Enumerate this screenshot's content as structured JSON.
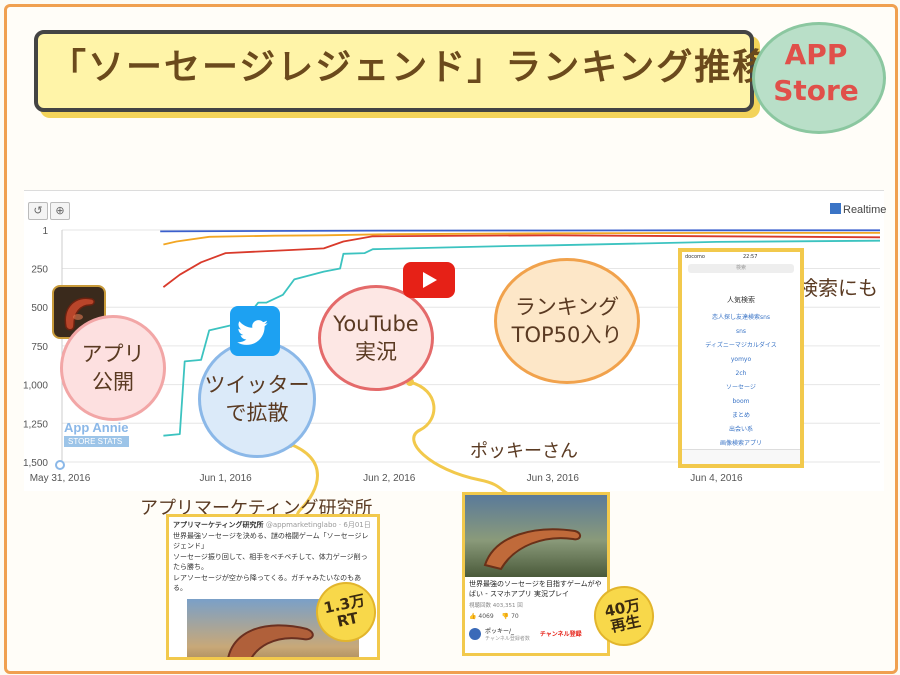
{
  "header": {
    "title": "「ソーセージレジェンド」ランキング推移",
    "badge_line1": "APP",
    "badge_line2": "Store"
  },
  "toolbar": {
    "realtime_label": "Realtime"
  },
  "chart_data": {
    "type": "line",
    "title": "",
    "xlabel": "",
    "ylabel": "",
    "y_inverted": true,
    "ylim": [
      1,
      1500
    ],
    "y_ticks": [
      "1",
      "250",
      "500",
      "750",
      "1,000",
      "1,250",
      "1,500"
    ],
    "y_tick_values": [
      1,
      250,
      500,
      750,
      1000,
      1250,
      1500
    ],
    "x_ticks": [
      "May 31, 2016",
      "Jun 1, 2016",
      "Jun 2, 2016",
      "Jun 3, 2016",
      "Jun 4, 2016"
    ],
    "x_tick_values": [
      0,
      1,
      2,
      3,
      4
    ],
    "xlim": [
      0,
      5
    ],
    "grid": "horizontal",
    "series": [
      {
        "color": "#3a5fcd",
        "points": [
          [
            0.6,
            10
          ],
          [
            1.0,
            8
          ],
          [
            2.0,
            5
          ],
          [
            3.0,
            4
          ],
          [
            4.0,
            3
          ],
          [
            5.0,
            3
          ]
        ]
      },
      {
        "color": "#f2a623",
        "points": [
          [
            0.62,
            95
          ],
          [
            0.7,
            75
          ],
          [
            0.9,
            45
          ],
          [
            1.3,
            38
          ],
          [
            1.6,
            35
          ],
          [
            2.0,
            28
          ],
          [
            3.0,
            22
          ],
          [
            4.0,
            20
          ],
          [
            5.0,
            20
          ]
        ]
      },
      {
        "color": "#d93a2b",
        "points": [
          [
            0.62,
            370
          ],
          [
            0.72,
            290
          ],
          [
            0.85,
            210
          ],
          [
            1.0,
            150
          ],
          [
            1.4,
            130
          ],
          [
            1.6,
            120
          ],
          [
            1.72,
            75
          ],
          [
            1.9,
            42
          ],
          [
            2.2,
            40
          ],
          [
            3.0,
            35
          ],
          [
            4.0,
            42
          ],
          [
            5.0,
            48
          ]
        ]
      },
      {
        "color": "#3cc3c0",
        "points": [
          [
            0.62,
            1330
          ],
          [
            0.72,
            1320
          ],
          [
            0.75,
            850
          ],
          [
            0.85,
            840
          ],
          [
            0.9,
            650
          ],
          [
            1.1,
            600
          ],
          [
            1.2,
            470
          ],
          [
            1.25,
            470
          ],
          [
            1.35,
            420
          ],
          [
            1.42,
            320
          ],
          [
            1.6,
            270
          ],
          [
            1.7,
            250
          ],
          [
            1.72,
            155
          ],
          [
            1.85,
            150
          ],
          [
            1.9,
            125
          ],
          [
            2.3,
            115
          ],
          [
            2.7,
            105
          ],
          [
            3.0,
            100
          ],
          [
            4.0,
            78
          ],
          [
            5.0,
            70
          ]
        ]
      }
    ]
  },
  "annotations": {
    "app_release": "アプリ\n公開",
    "twitter": "ツイッター\nで拡散",
    "youtube": "YouTube\n実況",
    "ranking": "ランキング\nTOP50入り",
    "popular_search": "人気検索にも",
    "pokki": "ポッキーさん",
    "research": "アプリマーケティング研究所",
    "rt_line1": "1.3万",
    "rt_line2": "RT",
    "views_line1": "40万",
    "views_line2": "再生"
  },
  "app_annie": {
    "name": "App Annie",
    "sub": "STORE STATS"
  },
  "tweet": {
    "account": "アプリマーケティング研究所",
    "handle": "@appmarketinglabo · 6月01日",
    "line1": "世界最強ソーセージを決める、謎の格闘ゲーム「ソーセージレジェンド」",
    "line2": "ソーセージ振り回して、相手をベチベチして、体力ゲージ削ったら勝ち。",
    "line3": "レアソーセージが空から降ってくる。ガチャみたいなのもある。"
  },
  "youtube_card": {
    "title": "世界最強のソーセージを目指すゲームがやばい - スマホアプリ 実況プレイ",
    "views": "視聴回数 403,351 回",
    "likes": "4069",
    "dislikes": "70",
    "channel": "ポッキー/_",
    "channel_sub": "チャンネル登録者数",
    "subscribe": "チャンネル登録"
  },
  "phone": {
    "carrier": "docomo",
    "time": "22:57",
    "search": "検索",
    "section": "人気検索",
    "items": [
      "恋人探し友達検索sns",
      "sns",
      "ディズニーマジカルダイス",
      "yomyo",
      "2ch",
      "ソーセージ",
      "boom",
      "まとめ",
      "出会い系",
      "画像検索アプリ"
    ]
  }
}
